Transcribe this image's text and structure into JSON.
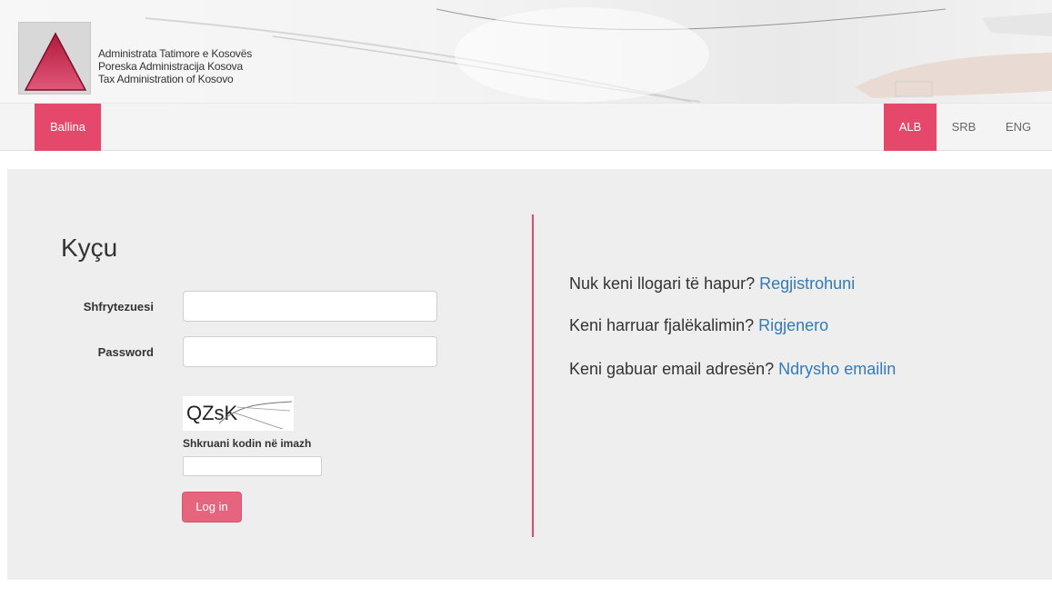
{
  "header": {
    "org_names": [
      "Administrata Tatimore e Kosovës",
      "Poreska Administracija Kosova",
      "Tax Administration of Kosovo"
    ],
    "logo_icon": "triangle-logo-icon"
  },
  "nav": {
    "home_label": "Ballina",
    "languages": [
      {
        "label": "ALB",
        "active": true
      },
      {
        "label": "SRB",
        "active": false
      },
      {
        "label": "ENG",
        "active": false
      }
    ]
  },
  "login": {
    "title": "Kyçu",
    "username_label": "Shfrytezuesi",
    "username_value": "",
    "password_label": "Password",
    "password_value": "",
    "captcha_text": "QZsK",
    "captcha_hint": "Shkruani kodin në imazh",
    "captcha_value": "",
    "submit_label": "Log in"
  },
  "help": {
    "register_prompt": "Nuk keni llogari të hapur?",
    "register_link": "Regjistrohuni",
    "forgot_prompt": "Keni harruar fjalëkalimin?",
    "forgot_link": "Rigjenero",
    "email_prompt": "Keni gabuar email adresën?",
    "email_link": "Ndrysho emailin"
  },
  "colors": {
    "accent": "#e5486a",
    "link": "#337ab7",
    "panel": "#eeeeee"
  }
}
